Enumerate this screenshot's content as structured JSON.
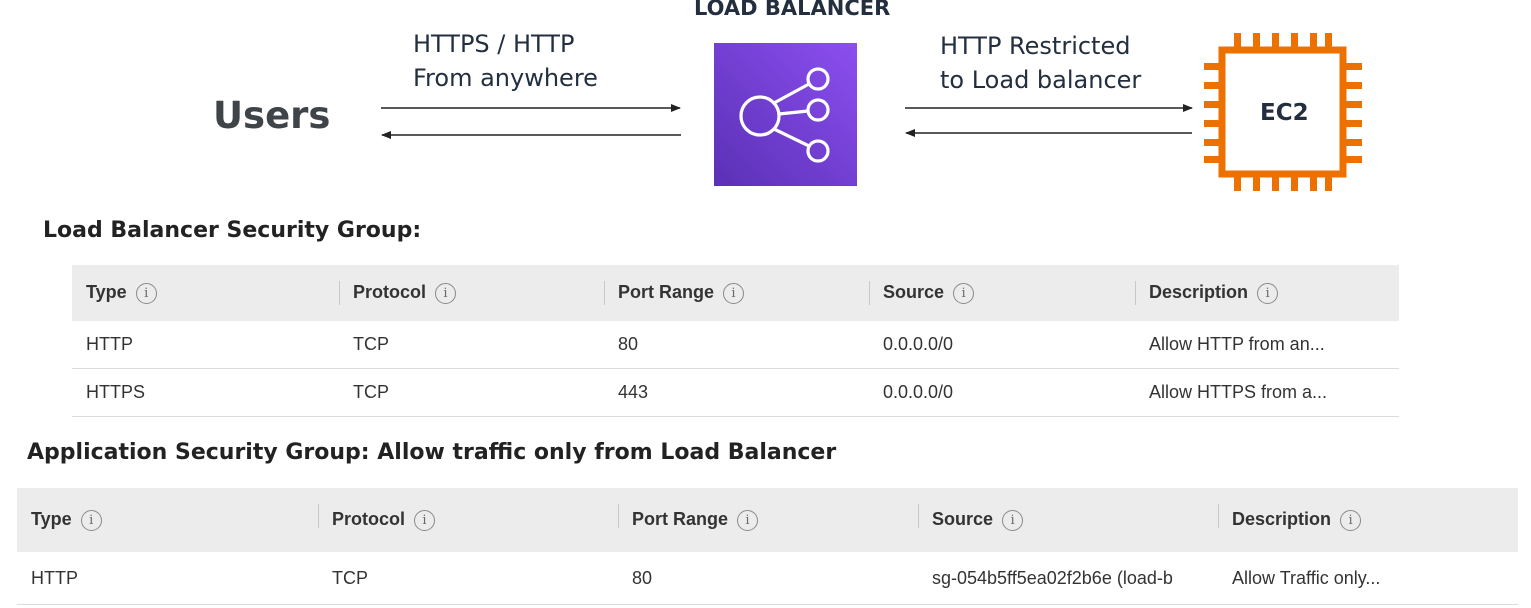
{
  "diagram": {
    "lb_title": "LOAD BALANCER",
    "users_label": "Users",
    "left_label_line1": "HTTPS / HTTP",
    "left_label_line2": "From anywhere",
    "right_label_line1": "HTTP Restricted",
    "right_label_line2": "to Load balancer",
    "ec2_label": "EC2",
    "lb_icon": "elastic-load-balancer-icon",
    "ec2_icon": "ec2-chip-icon",
    "colors": {
      "lb_gradient_start": "#8c4ff0",
      "lb_gradient_end": "#5a30b5",
      "ec2_orange": "#ed7100"
    }
  },
  "lb_sg": {
    "title": "Load Balancer Security Group:",
    "headers": [
      "Type",
      "Protocol",
      "Port Range",
      "Source",
      "Description"
    ],
    "rows": [
      [
        "HTTP",
        "TCP",
        "80",
        "0.0.0.0/0",
        "Allow HTTP from an..."
      ],
      [
        "HTTPS",
        "TCP",
        "443",
        "0.0.0.0/0",
        "Allow HTTPS from a..."
      ]
    ]
  },
  "app_sg": {
    "title": "Application Security Group: Allow traffic only from Load Balancer",
    "headers": [
      "Type",
      "Protocol",
      "Port Range",
      "Source",
      "Description"
    ],
    "rows": [
      [
        "HTTP",
        "TCP",
        "80",
        "sg-054b5ff5ea02f2b6e (load-b",
        "Allow Traffic only..."
      ]
    ]
  }
}
